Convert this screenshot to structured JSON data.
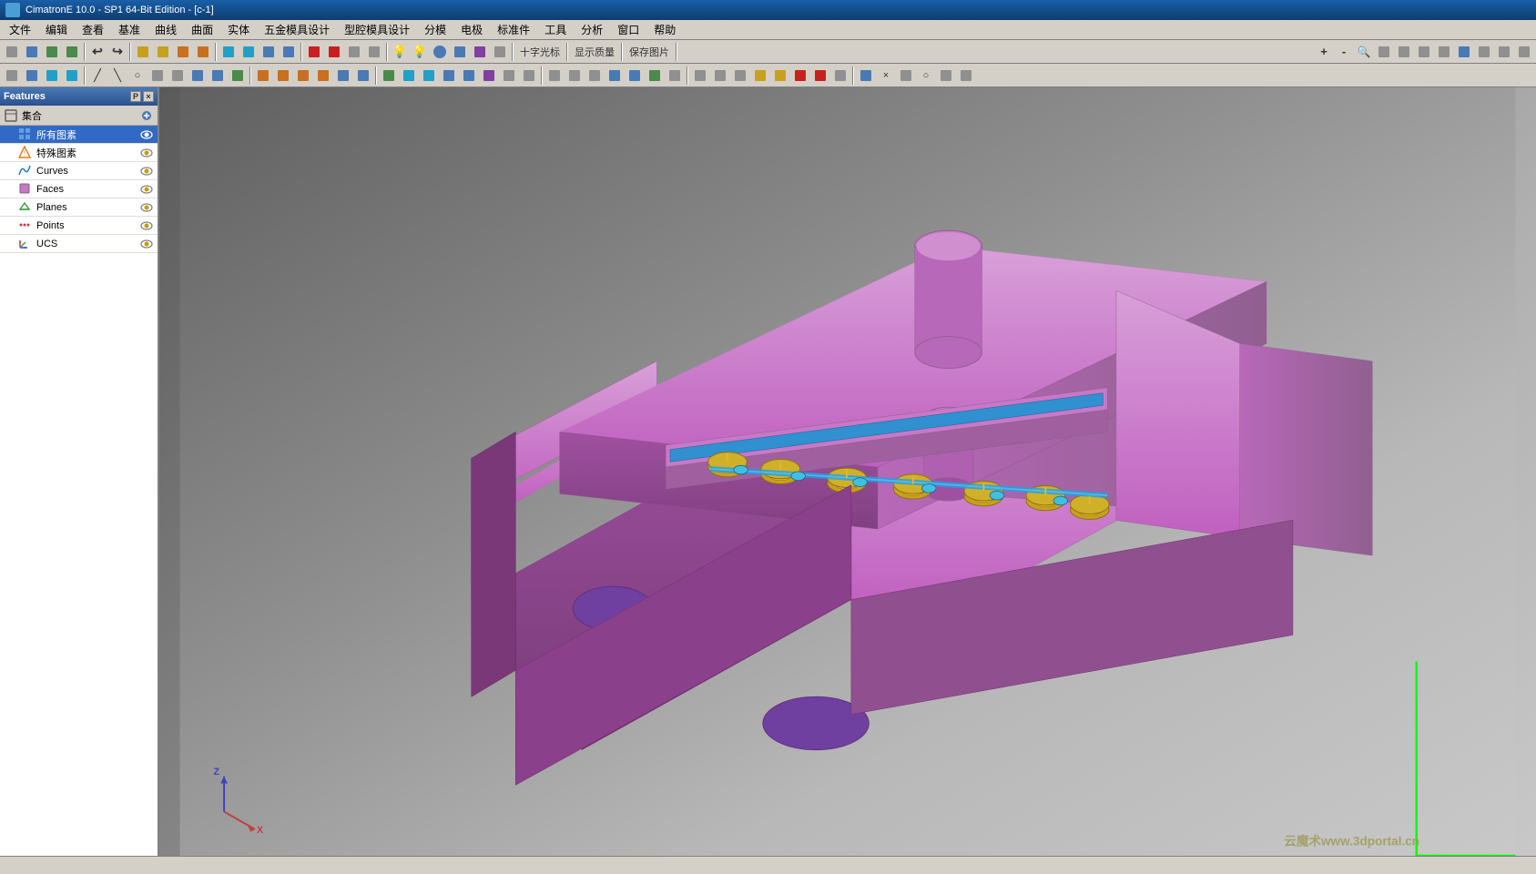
{
  "titlebar": {
    "title": "CimatronE 10.0 - SP1 64-Bit Edition - [c-1]",
    "icon": "cimatron-icon"
  },
  "menubar": {
    "items": [
      "文件",
      "编辑",
      "查看",
      "基准",
      "曲线",
      "曲面",
      "实体",
      "五金模具设计",
      "型腔模具设计",
      "分模",
      "电极",
      "标准件",
      "工具",
      "分析",
      "窗口",
      "帮助"
    ]
  },
  "features_panel": {
    "title": "Features",
    "pin_label": "P",
    "close_label": "×",
    "group": {
      "label": "集合",
      "icon": "group-icon"
    },
    "items": [
      {
        "label": "所有图素",
        "selected": true,
        "icon": "all-elements-icon",
        "visible": true
      },
      {
        "label": "特殊图素",
        "selected": false,
        "icon": "special-elements-icon",
        "visible": true
      },
      {
        "label": "Curves",
        "selected": false,
        "icon": "curves-icon",
        "visible": true
      },
      {
        "label": "Faces",
        "selected": false,
        "icon": "faces-icon",
        "visible": true
      },
      {
        "label": "Planes",
        "selected": false,
        "icon": "planes-icon",
        "visible": true
      },
      {
        "label": "Points",
        "selected": false,
        "icon": "points-icon",
        "visible": true
      },
      {
        "label": "UCS",
        "selected": false,
        "icon": "ucs-icon",
        "visible": true
      }
    ]
  },
  "viewport": {
    "model_color": "#c878c8",
    "background_top": "#5a5a5a",
    "background_bottom": "#c8c8c8"
  },
  "watermark": {
    "text": "云魔术www.3dportal.cn"
  },
  "statusbar": {
    "text": ""
  }
}
